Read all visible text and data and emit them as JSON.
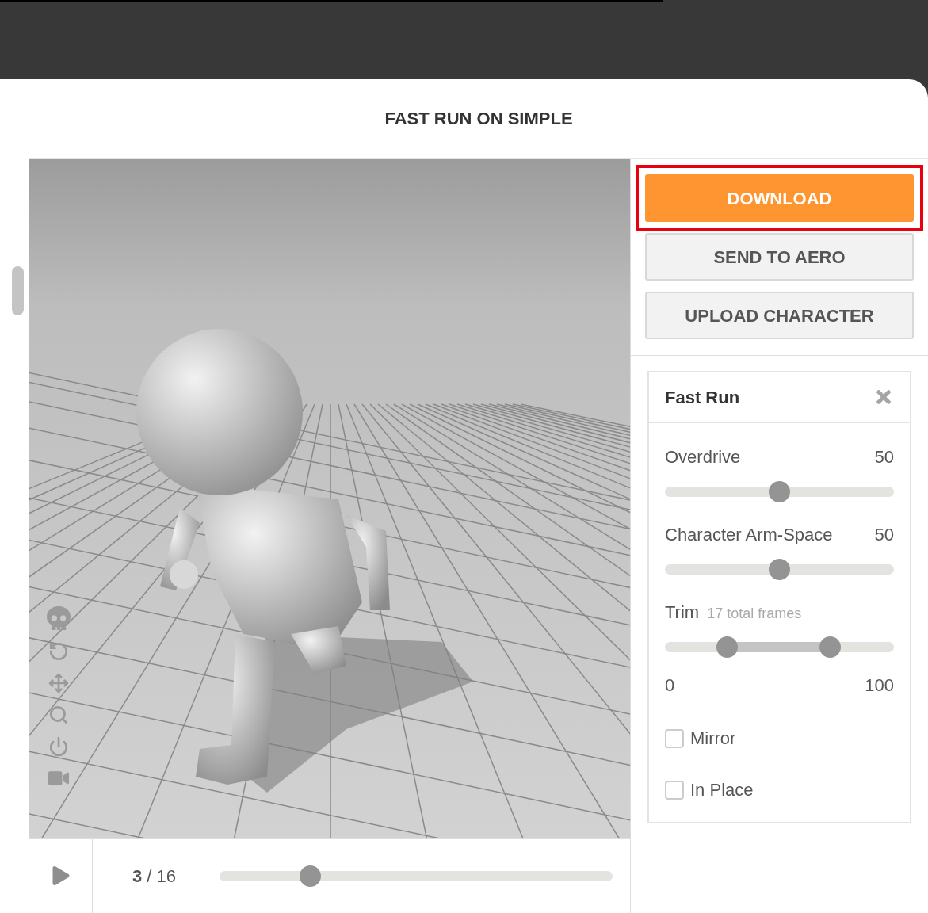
{
  "header": {
    "title": "FAST RUN ON SIMPLE"
  },
  "actions": [
    {
      "label": "DOWNLOAD",
      "kind": "primary",
      "highlighted": true
    },
    {
      "label": "SEND TO AERO",
      "kind": "secondary",
      "highlighted": false
    },
    {
      "label": "UPLOAD CHARACTER",
      "kind": "secondary",
      "highlighted": false
    }
  ],
  "settings": {
    "title": "Fast Run",
    "controls": [
      {
        "kind": "slider",
        "label": "Overdrive",
        "reading": "50",
        "level": 0.5
      },
      {
        "kind": "slider",
        "label": "Character Arm-Space",
        "reading": "50",
        "level": 0.5
      },
      {
        "kind": "range",
        "label": "Trim",
        "note": "17 total frames",
        "handles": [
          {
            "level": 0.27
          },
          {
            "level": 0.72
          }
        ],
        "min": "0",
        "max": "100"
      },
      {
        "kind": "checkbox",
        "label": "Mirror",
        "checked": false
      },
      {
        "kind": "checkbox",
        "label": "In Place",
        "checked": false
      }
    ]
  },
  "playback": {
    "playing": false,
    "counter": "**3** / 16",
    "level": 0.23
  }
}
